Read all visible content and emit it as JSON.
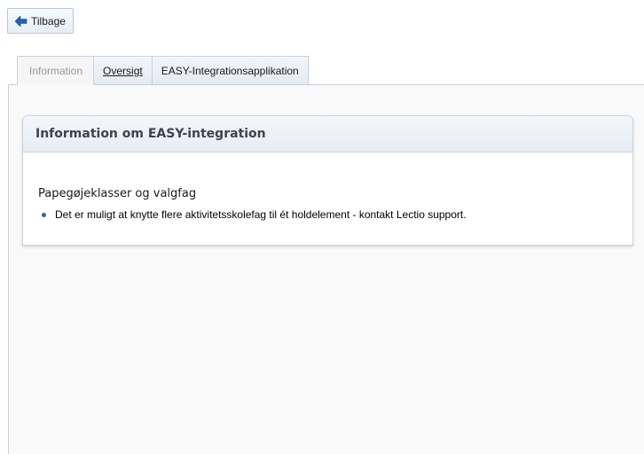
{
  "toolbar": {
    "back_label": "Tilbage"
  },
  "tabs": [
    {
      "label": "Information",
      "active": true
    },
    {
      "label": "Oversigt",
      "active": false
    },
    {
      "label": "EASY-Integrationsapplikation",
      "active": false
    }
  ],
  "info_box": {
    "title": "Information om EASY-integration",
    "section_title": "Papegøjeklasser og valgfag",
    "items": [
      "Det er muligt at knytte flere aktivitetsskolefag til ét holdelement - kontakt Lectio support."
    ]
  },
  "colors": {
    "accent": "#1f64b4",
    "bullet": "#3b5e9c",
    "header_text": "#3a4450"
  },
  "icons": {
    "back": "arrow-left-icon"
  }
}
